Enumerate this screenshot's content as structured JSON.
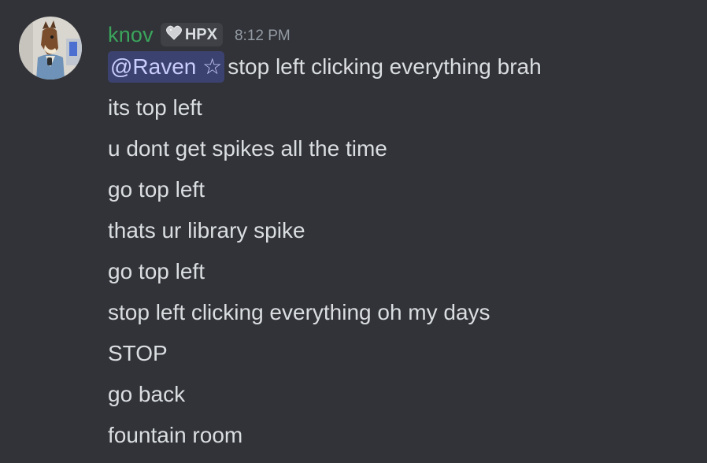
{
  "message": {
    "author": {
      "username": "knov",
      "username_color": "#3ba55c",
      "avatar_icon": "avatar-image"
    },
    "tag": {
      "icon": "heart-icon",
      "label": "HPX"
    },
    "timestamp": "8:12 PM",
    "mention": "@Raven ☆",
    "lines": [
      "stop left clicking everything brah",
      "its top left",
      "u dont get spikes all the time",
      "go top left",
      "thats ur library spike",
      "go top left",
      "stop left clicking everything oh my days",
      "STOP",
      "go back",
      "fountain room"
    ]
  },
  "colors": {
    "background": "#313338",
    "text": "#dbdee1",
    "muted": "#949ba4",
    "mention_bg": "#3c4270",
    "mention_text": "#c9cdfb",
    "tag_bg": "#3f4147"
  }
}
